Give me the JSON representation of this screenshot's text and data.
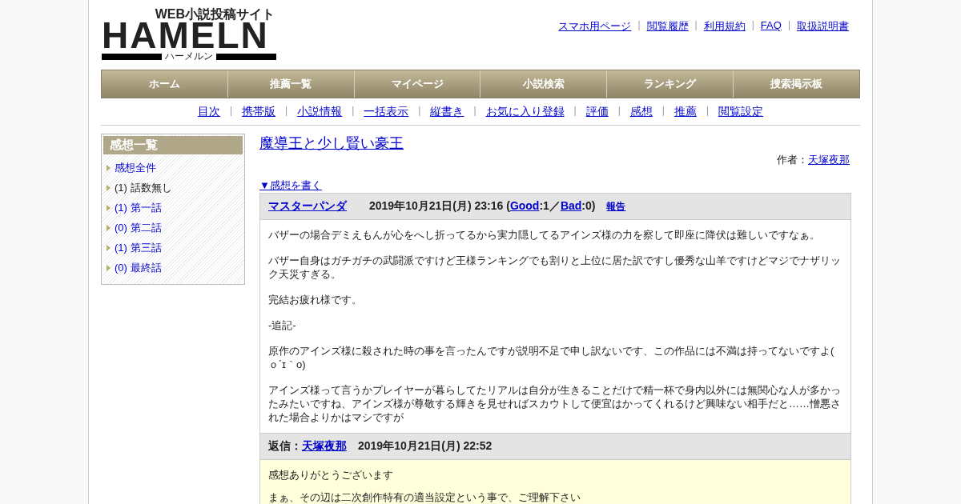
{
  "logo": {
    "tagline": "WEB小説投稿サイト",
    "wordmark": "HAMELN",
    "subtitle": "ハーメルン"
  },
  "top_links": {
    "separator": "|",
    "items": [
      "スマホ用ページ",
      "閲覧履歴",
      "利用規約",
      "FAQ",
      "取扱説明書"
    ]
  },
  "nav": [
    "ホーム",
    "推薦一覧",
    "マイページ",
    "小説検索",
    "ランキング",
    "捜索掲示板"
  ],
  "sub_nav": {
    "separator": "|",
    "items": [
      "目次",
      "携帯版",
      "小説情報",
      "一括表示",
      "縦書き",
      "お気に入り登録",
      "評価",
      "感想",
      "推薦",
      "閲覧設定"
    ]
  },
  "sidebar": {
    "title": "感想一覧",
    "items": [
      {
        "label": "感想全件",
        "selected": false
      },
      {
        "label": "(1) 話数無し",
        "selected": true
      },
      {
        "label": "(1) 第一話",
        "selected": false
      },
      {
        "label": "(0) 第二話",
        "selected": false
      },
      {
        "label": "(1) 第三話",
        "selected": false
      },
      {
        "label": "(0) 最終話",
        "selected": false
      }
    ]
  },
  "novel": {
    "title": "魔導王と少し賢い豪王",
    "author_label": "作者：",
    "author": "天塚夜那",
    "write_link": "▼感想を書く"
  },
  "comment": {
    "author": "マスターパンダ",
    "meta_before": "2019年10月21日(月) 23:16 (",
    "good": "Good",
    "good_count": ":1／",
    "bad": "Bad",
    "bad_count": ":0)",
    "report": "報告",
    "paragraphs": [
      "バザーの場合デミえもんが心をへし折ってるから実力隠してるアインズ様の力を察して即座に降伏は難しいですなぁ。",
      "バザー自身はガチガチの武闘派ですけど王様ランキングでも割りと上位に居た訳ですし優秀な山羊ですけどマジでナザリック天災すぎる。",
      "完結お疲れ様です。",
      "-追記-",
      "原作のアインズ様に殺された時の事を言ったんですが説明不足で申し訳ないです、この作品には不満は持ってないですよ( ｏ´ɪ｀o)",
      "アインズ様って言うかプレイヤーが暮らしてたリアルは自分が生きることだけで精一杯で身内以外には無関心な人が多かったみたいですね、アインズ様が尊敬する輝きを見せればスカウトして便宜はかってくれるけど興味ない相手だと……憎悪された場合よりかはマシですが"
    ]
  },
  "reply": {
    "label": "返信：",
    "author": "天塚夜那",
    "date": "2019年10月21日(月) 22:52",
    "paragraphs": [
      "感想ありがとうございます",
      "まぁ、その辺は二次創作特有の適当設定という事で、ご理解下さい"
    ]
  }
}
